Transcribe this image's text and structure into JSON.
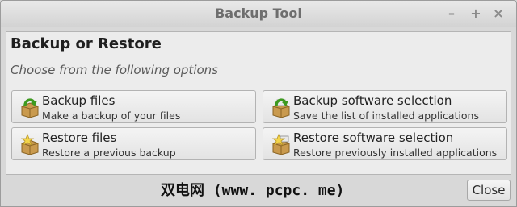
{
  "window": {
    "title": "Backup Tool",
    "controls": {
      "minimize": "–",
      "maximize": "+",
      "close": "×"
    }
  },
  "main": {
    "heading": "Backup or Restore",
    "subheading": "Choose from the following options",
    "options": [
      {
        "label": "Backup files",
        "description": "Make a backup of your files",
        "icon": "box-with-green-arrow-icon"
      },
      {
        "label": "Backup software selection",
        "description": "Save the list of installed applications",
        "icon": "box-with-green-arrow-icon"
      },
      {
        "label": "Restore files",
        "description": "Restore a previous backup",
        "icon": "box-with-star-icon"
      },
      {
        "label": "Restore software selection",
        "description": "Restore previously installed applications",
        "icon": "box-with-star-icon"
      }
    ]
  },
  "footer": {
    "watermark": "双电网 (www. pcpc. me)",
    "close_label": "Close"
  }
}
